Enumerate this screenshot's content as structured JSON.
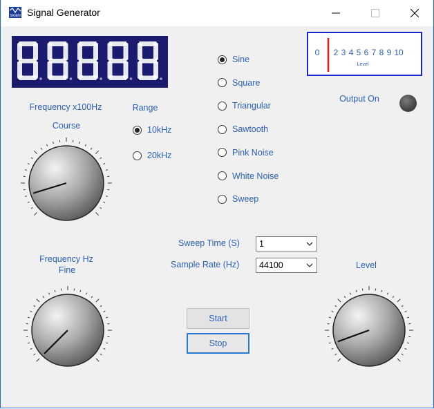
{
  "window": {
    "title": "Signal Generator"
  },
  "display": {
    "digits": [
      "8",
      "8",
      "8",
      "8",
      "8"
    ]
  },
  "waveforms": [
    {
      "label": "Sine",
      "selected": true
    },
    {
      "label": "Square",
      "selected": false
    },
    {
      "label": "Triangular",
      "selected": false
    },
    {
      "label": "Sawtooth",
      "selected": false
    },
    {
      "label": "Pink Noise",
      "selected": false
    },
    {
      "label": "White Noise",
      "selected": false
    },
    {
      "label": "Sweep",
      "selected": false
    }
  ],
  "level_meter": {
    "ticks": [
      "0",
      "2",
      "3",
      "4",
      "5",
      "6",
      "7",
      "8",
      "9",
      "10"
    ],
    "caption": "Level",
    "needle_color": "#d81a1a",
    "border_color": "#1a23d0"
  },
  "output": {
    "label": "Output On"
  },
  "range": {
    "label": "Range",
    "options": [
      {
        "label": "10kHz",
        "selected": true
      },
      {
        "label": "20kHz",
        "selected": false
      }
    ]
  },
  "coarse": {
    "label_top": "Frequency x100Hz",
    "label": "Course"
  },
  "fine": {
    "label_line1": "Frequency Hz",
    "label_line2": "Fine"
  },
  "level_knob": {
    "label": "Level"
  },
  "sweep_time": {
    "label": "Sweep Time (S)",
    "value": "1"
  },
  "sample_rate": {
    "label": "Sample Rate (Hz)",
    "value": "44100"
  },
  "buttons": {
    "start": "Start",
    "stop": "Stop"
  },
  "colors": {
    "label_text": "#2b5fb6",
    "display_bg": "#1a1a6e",
    "window_border": "#1e6fd9"
  }
}
